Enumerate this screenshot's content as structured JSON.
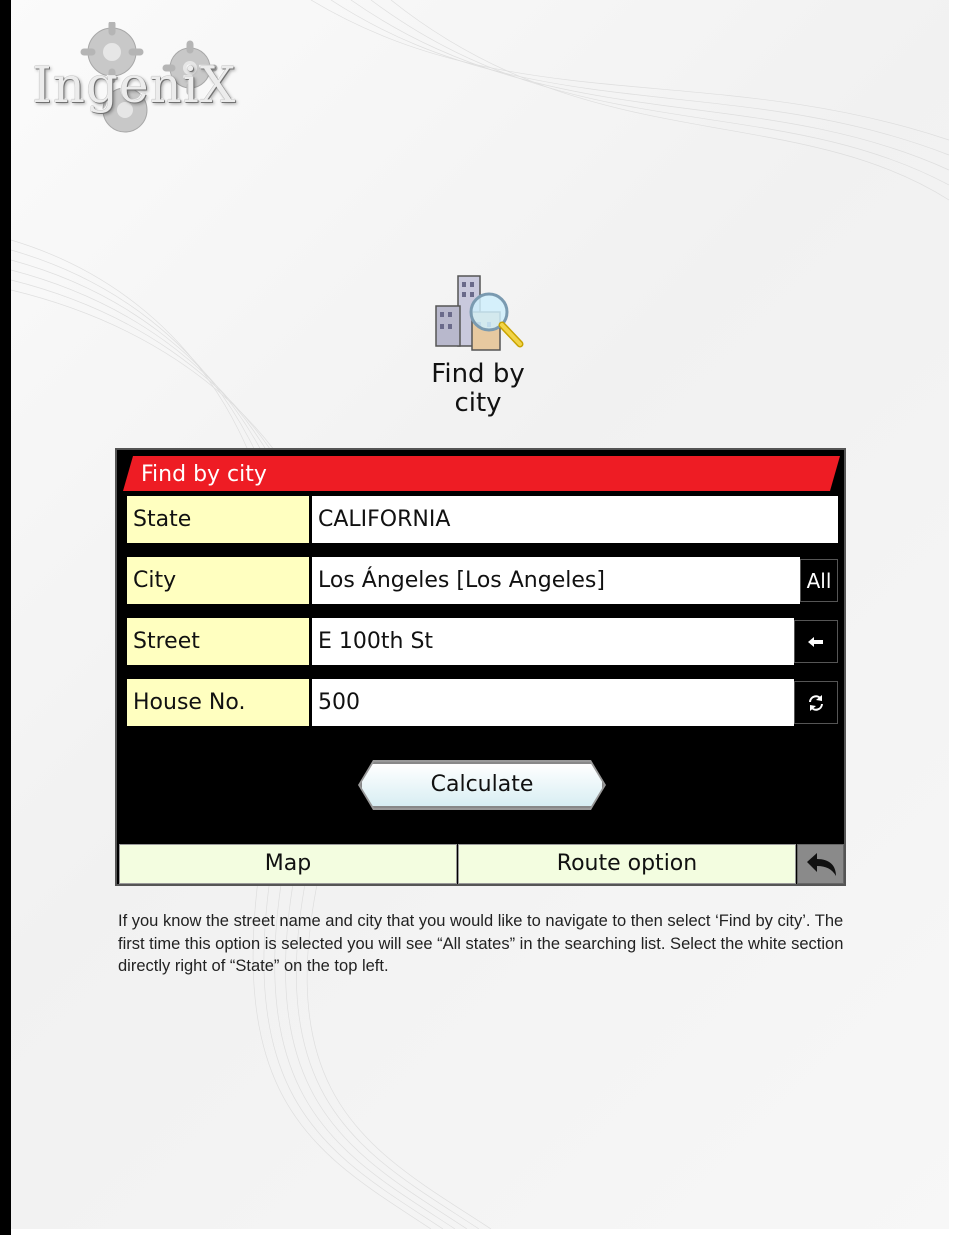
{
  "brand": {
    "logo_text": "IngeniX"
  },
  "feature": {
    "label_line1": "Find by",
    "label_line2": "city"
  },
  "dialog": {
    "title": "Find by city",
    "fields": [
      {
        "label": "State",
        "value": "CALIFORNIA"
      },
      {
        "label": "City",
        "value": "Los Ángeles [Los Angeles]",
        "button": "All"
      },
      {
        "label": "Street",
        "value": "E 100th St"
      },
      {
        "label": "House No.",
        "value": "500"
      }
    ],
    "calculate_label": "Calculate",
    "bottom": {
      "map_label": "Map",
      "route_label": "Route option"
    }
  },
  "colors": {
    "title_bar": "#ee1c24",
    "label_bg": "#ffffc0",
    "screen_bg": "#000000",
    "bottom_tab_bg": "#f3fde0"
  },
  "icons": {
    "street_button": "arrow-left-icon",
    "house_button": "cycle-arrows-icon",
    "back": "undo-arrow-icon",
    "feature": "city-buildings-magnifier-icon",
    "logo_decor": "gears-icon"
  },
  "description": "If you know the street name and city that you would like to navigate to then select ‘Find by city’. The first time this option is selected you will see “All states” in the searching list. Select the white section directly right of “State” on the top left."
}
